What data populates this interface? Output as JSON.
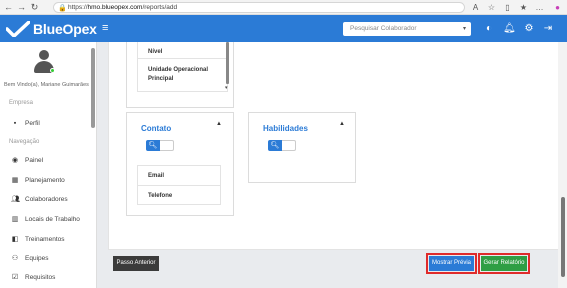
{
  "browser": {
    "url_host": "hmo.blueopex.com",
    "url_prefix": "https://",
    "url_path": "/reports/add"
  },
  "header": {
    "brand": "BlueOpex",
    "search_placeholder": "Pesquisar Colaborador"
  },
  "sidebar": {
    "welcome": "Bem Vindo(a), Mariane Guimarães",
    "section_empresa": "Empresa",
    "section_navegacao": "Navegação",
    "items": [
      {
        "label": "Perfil",
        "icon": "briefcase-icon"
      },
      {
        "label": "Painel",
        "icon": "dashboard-icon"
      },
      {
        "label": "Planejamento",
        "icon": "calendar-icon"
      },
      {
        "label": "Colaboradores",
        "icon": "users-icon"
      },
      {
        "label": "Locais de Trabalho",
        "icon": "building-icon"
      },
      {
        "label": "Treinamentos",
        "icon": "training-icon"
      },
      {
        "label": "Equipes",
        "icon": "team-icon"
      },
      {
        "label": "Requisitos",
        "icon": "checklist-icon"
      }
    ]
  },
  "cards": {
    "top_list": [
      "Nível",
      "Unidade Operacional Principal"
    ],
    "contato": {
      "title": "Contato",
      "items": [
        "Email",
        "Telefone"
      ]
    },
    "habilidades": {
      "title": "Habilidades"
    }
  },
  "buttons": {
    "previous": "Passo Anterior",
    "preview": "Mostrar Prévia",
    "generate": "Gerar Relatório"
  },
  "colors": {
    "brand": "#2b7bd6",
    "generate": "#2f9e44",
    "highlight": "#e02b2b"
  }
}
